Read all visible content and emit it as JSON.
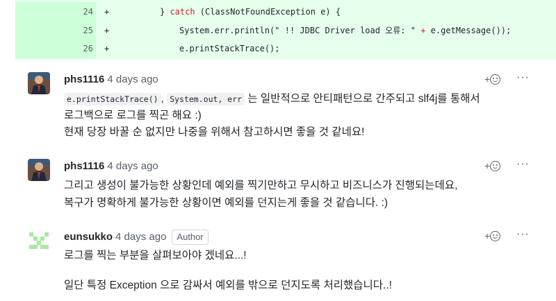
{
  "diff": {
    "lines": [
      {
        "num": "24",
        "sign": "+",
        "indent": "        ",
        "pre": "} ",
        "kw": "catch",
        "post": " (ClassNotFoundException e) {"
      },
      {
        "num": "25",
        "sign": "+",
        "indent": "            ",
        "pre": "System.err.println(\" !! JDBC Driver load 오류: \" ",
        "kw": "+",
        "post": " e.getMessage());"
      },
      {
        "num": "26",
        "sign": "+",
        "indent": "            ",
        "pre": "e.printStackTrace();",
        "kw": "",
        "post": ""
      }
    ]
  },
  "comments": [
    {
      "user": "phs1116",
      "time": "4 days ago",
      "react_plus": "+",
      "more": "···",
      "code1": "e.printStackTrace()",
      "sep1": ",",
      "code2": "System.out, err",
      "line1_rest": " 는 일반적으로 안티패턴으로 간주되고 slf4j를 통해서",
      "line2": "로그백으로 로그를 찍곤 해요 :)",
      "line3": "현재 당장 바꿀 순 없지만 나중을 위해서 참고하시면 좋을 것 같네요!"
    },
    {
      "user": "phs1116",
      "time": "4 days ago",
      "react_plus": "+",
      "more": "···",
      "line1": "그리고 생성이 불가능한 상황인데 예외를 찍기만하고 무시하고 비즈니스가 진행되는데요,",
      "line2": "복구가 명확하게 불가능한 상황이면 예외를 던지는게 좋을 것 같습니다. :)"
    },
    {
      "user": "eunsukko",
      "time": "4 days ago",
      "badge": "Author",
      "react_plus": "+",
      "more": "···",
      "line1": "로그를 찍는 부분을 살펴보아야 겠네요...!",
      "line2": "일단 특정 Exception 으로 감싸서 예외를 밖으로 던지도록 처리했습니다..!"
    }
  ]
}
